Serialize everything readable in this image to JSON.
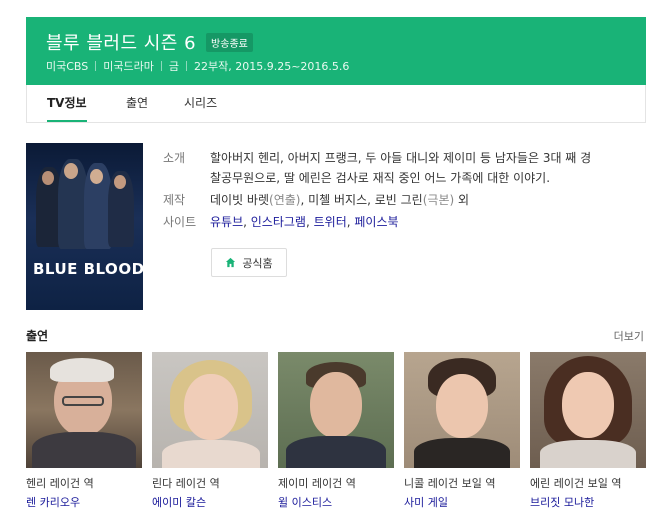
{
  "header": {
    "title": "블루 블러드 시즌 6",
    "badge": "방송종료",
    "meta": [
      "미국CBS",
      "미국드라마",
      "금",
      "22부작, 2015.9.25~2016.5.6"
    ],
    "bg_color": "#19b377"
  },
  "tabs": [
    {
      "label": "TV정보",
      "active": true
    },
    {
      "label": "출연",
      "active": false
    },
    {
      "label": "시리즈",
      "active": false
    }
  ],
  "poster": {
    "logo_text": "BLUE BLOODS"
  },
  "info": {
    "summary_label": "소개",
    "summary_line1": "할아버지 헨리, 아버지 프랭크, 두 아들 대니와 제이미 등 남자들은 3대 째 경",
    "summary_line2": "찰공무원으로, 딸 에린은 검사로 재직 중인 어느 가족에 대한 이야기.",
    "production_label": "제작",
    "production_part1": "데이빗 바렛",
    "production_part1_role": "(연출)",
    "production_part2": ", 미첼 버지스, 로빈 그린",
    "production_part2_role": "(극본)",
    "production_part3": " 외",
    "site_label": "사이트",
    "sites": [
      "유튜브",
      "인스타그램",
      "트위터",
      "페이스북"
    ],
    "site_sep": ", ",
    "official_button": "공식홈"
  },
  "cast": {
    "title": "출연",
    "more": "더보기",
    "members": [
      {
        "role": "헨리 레이건 역",
        "name": "렌 카리오우"
      },
      {
        "role": "린다 레이건 역",
        "name": "에이미 칼슨"
      },
      {
        "role": "제이미 레이건 역",
        "name": "윌 이스티스"
      },
      {
        "role": "니콜 레이건 보일 역",
        "name": "사미 게일"
      },
      {
        "role": "에린 레이건 보일 역",
        "name": "브리짓 모나한"
      }
    ]
  },
  "colors": {
    "accent": "#19b377",
    "link": "#1a1a9a"
  }
}
